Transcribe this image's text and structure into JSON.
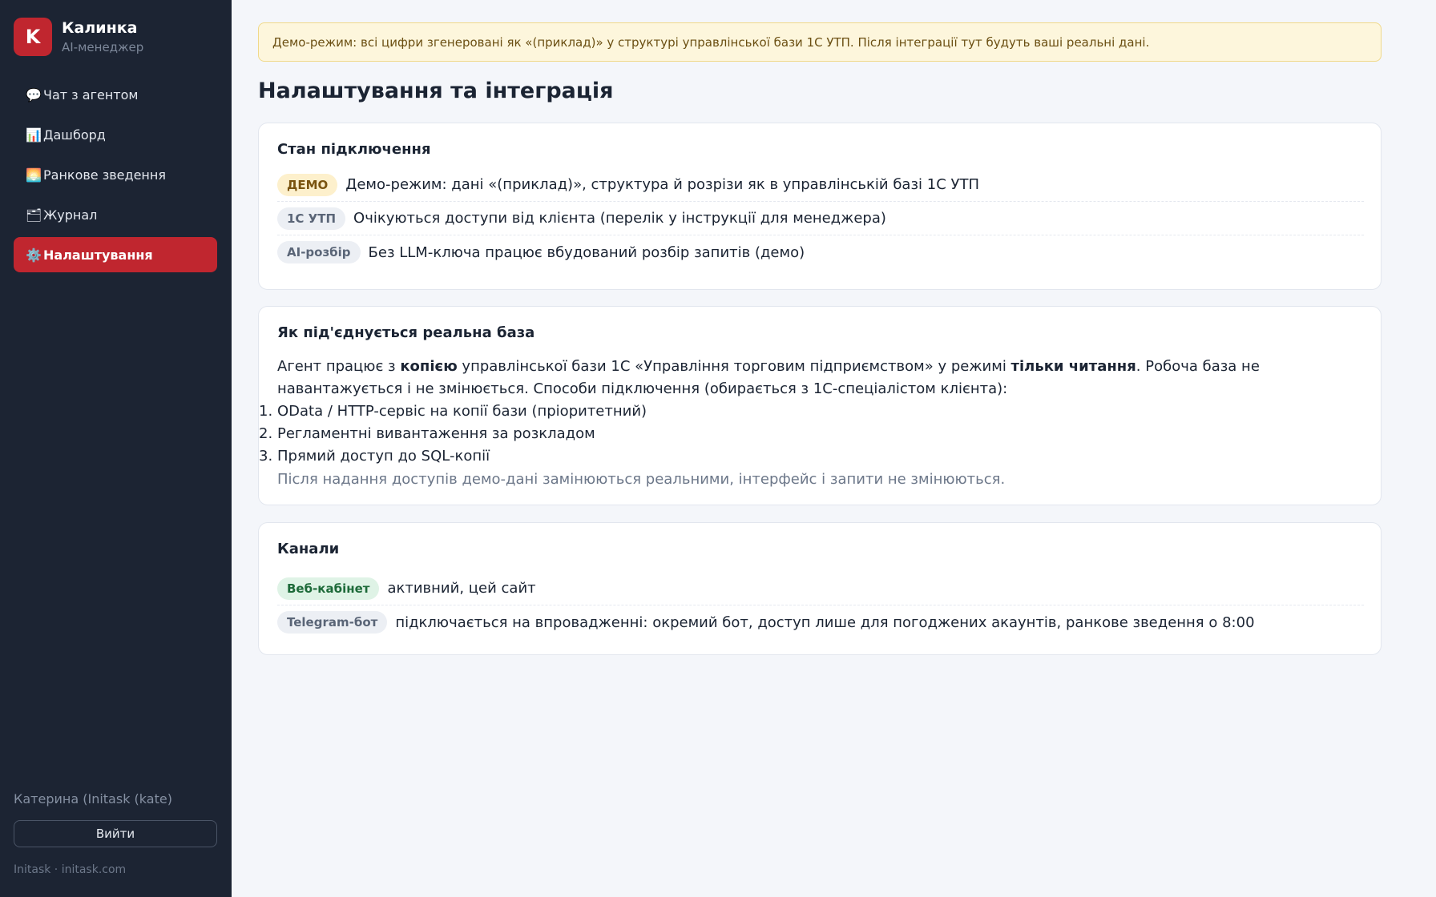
{
  "sidebar": {
    "logo_letter": "K",
    "brand_name": "Калинка",
    "brand_sub": "AI-менеджер",
    "items": [
      {
        "icon": "💬",
        "label": "Чат з агентом"
      },
      {
        "icon": "📊",
        "label": "Дашборд"
      },
      {
        "icon": "🌅",
        "label": "Ранкове зведення"
      },
      {
        "icon": "🗂",
        "label": "Журнал"
      },
      {
        "icon": "⚙️",
        "label": "Налаштування",
        "active": true
      }
    ],
    "user_name": "Катерина (Initask (kate)",
    "logout_label": "Вийти",
    "footer": "Initask · initask.com"
  },
  "banner": "Демо-режим: всі цифри згенеровані як «(приклад)» у структурі управлінської бази 1С УТП. Після інтеграції тут будуть ваші реальні дані.",
  "page_title": "Налаштування та інтеграція",
  "connection": {
    "title": "Стан підключення",
    "rows": [
      {
        "badge": "ДЕМО",
        "text": "Демо-режим: дані «(приклад)», структура й розрізи як в управлінській базі 1С УТП"
      },
      {
        "badge": "1С УТП",
        "text": "Очікуються доступи від клієнта (перелік у інструкції для менеджера)"
      },
      {
        "badge": "AI-розбір",
        "text": "Без LLM-ключа працює вбудований розбір запитів (демо)"
      }
    ]
  },
  "howto": {
    "title": "Як під'єднується реальна база",
    "p1_a": "Агент працює з ",
    "p1_b": "копією",
    "p1_c": " управлінської бази 1С «Управління торговим підприємством» у режимі ",
    "p1_d": "тільки читання",
    "p1_e": ". Робоча база не",
    "p2": "навантажується і не змінюється. Способи підключення (обирається з 1С-спеціалістом клієнта):",
    "steps": [
      "OData / HTTP-сервіс на копії бази (пріоритетний)",
      "Регламентні вивантаження за розкладом",
      "Прямий доступ до SQL-копії"
    ],
    "note": "Після надання доступів демо-дані замінюються реальними, інтерфейс і запити не змінюються."
  },
  "channels": {
    "title": "Канали",
    "rows": [
      {
        "badge": "Веб-кабінет",
        "text": "активний, цей сайт"
      },
      {
        "badge": "Telegram-бот",
        "text": "підключається на впровадженні: окремий бот, доступ лише для погоджених акаунтів, ранкове зведення о 8:00"
      }
    ]
  },
  "colors": {
    "accent": "#c0262f",
    "sidebar_bg": "#1c2433",
    "banner_bg": "#fdf6dc"
  }
}
